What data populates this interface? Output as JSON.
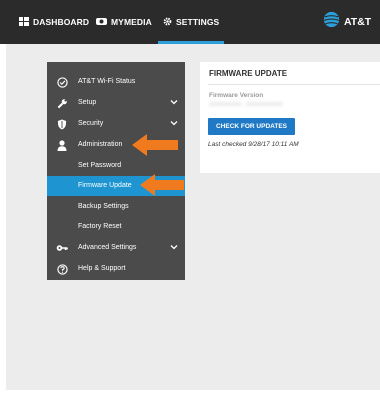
{
  "topnav": {
    "items": [
      {
        "label": "DASHBOARD",
        "icon": "dashboard-grid-icon"
      },
      {
        "label": "MYMEDIA",
        "icon": "media-icon"
      },
      {
        "label": "SETTINGS",
        "icon": "gear-icon",
        "active": true
      }
    ],
    "brand": {
      "name": "AT&T",
      "icon": "att-globe-icon"
    }
  },
  "sidebar": {
    "items": [
      {
        "label": "AT&T Wi-Fi Status",
        "icon": "checkmark-circle-icon"
      },
      {
        "label": "Setup",
        "icon": "wrench-icon",
        "expandable": true
      },
      {
        "label": "Security",
        "icon": "shield-icon",
        "expandable": true
      },
      {
        "label": "Administration",
        "icon": "person-icon",
        "highlighted_by_arrow": true
      },
      {
        "label": "Set Password"
      },
      {
        "label": "Firmware Update",
        "selected": true,
        "highlighted_by_arrow": true
      },
      {
        "label": "Backup Settings"
      },
      {
        "label": "Factory Reset"
      },
      {
        "label": "Advanced Settings",
        "icon": "key-icon",
        "expandable": true
      },
      {
        "label": "Help & Support",
        "icon": "question-circle-icon"
      }
    ]
  },
  "firmware": {
    "title": "FIRMWARE UPDATE",
    "version_label": "Firmware Version",
    "version_value": "XXXXXXXX - XXXXXXXXX",
    "check_button": "CHECK FOR UPDATES",
    "last_checked": "Last checked 9/28/17 10:11 AM"
  },
  "colors": {
    "topbar": "#2b2b2b",
    "accent": "#1e95d1",
    "button": "#1f79c5",
    "arrow": "#f07b1e",
    "sidebar": "#4b4b4b"
  }
}
